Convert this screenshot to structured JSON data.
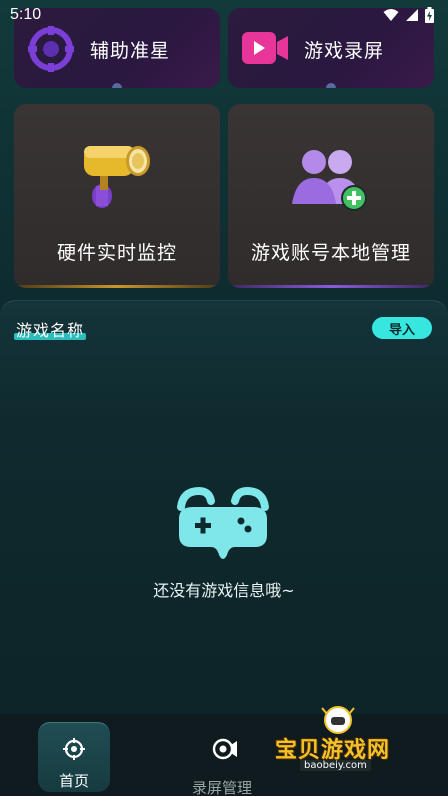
{
  "status_bar": {
    "time": "5:10"
  },
  "top_cards": [
    {
      "label": "辅助准星",
      "icon": "crosshair-icon"
    },
    {
      "label": "游戏录屏",
      "icon": "video-record-icon"
    }
  ],
  "feature_cards": [
    {
      "label": "硬件实时监控",
      "icon": "monitor-camera-icon",
      "accent": "#b88a2a"
    },
    {
      "label": "游戏账号本地管理",
      "icon": "users-add-icon",
      "accent": "#7b4fc9"
    }
  ],
  "panel": {
    "title": "游戏名称",
    "import_label": "导入",
    "empty_text": "还没有游戏信息哦~"
  },
  "bottom_nav": {
    "items": [
      {
        "label": "首页",
        "icon": "target-icon",
        "active": true
      },
      {
        "label": "录屏管理",
        "icon": "record-icon",
        "active": false
      }
    ]
  },
  "watermark": {
    "name": "宝贝游戏网",
    "url": "baobeiy.com"
  },
  "colors": {
    "accent": "#37e6df",
    "background": "#0f2a2e"
  }
}
